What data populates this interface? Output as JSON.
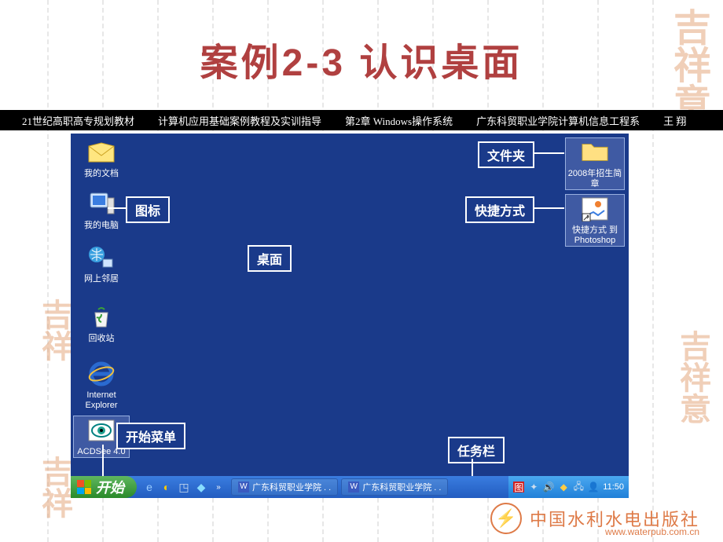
{
  "slide": {
    "title": "案例2-3  认识桌面"
  },
  "breadcrumb": {
    "b1": "21世纪高职高专规划教材",
    "b2": "计算机应用基础案例教程及实训指导",
    "b3": "第2章 Windows操作系统",
    "b4": "广东科贸职业学院计算机信息工程系",
    "b5": "王 翔"
  },
  "desktop": {
    "icons": {
      "mydocs": "我的文档",
      "mycomputer": "我的电脑",
      "network": "网上邻居",
      "recycle": "回收站",
      "ie": "Internet Explorer",
      "acdsee": "ACDSee 4.0",
      "folder2008": "2008年招生简章",
      "photoshop": "快捷方式 到 Photoshop"
    },
    "callouts": {
      "icon": "图标",
      "desktop": "桌面",
      "folder": "文件夹",
      "shortcut": "快捷方式",
      "startmenu": "开始菜单",
      "taskbar": "任务栏"
    },
    "taskbar": {
      "start": "开始",
      "task1": "广东科贸职业学院 . .",
      "task2": "广东科贸职业学院 . .",
      "time": "11:50"
    }
  },
  "brand": {
    "name": "中国水利水电出版社",
    "url": "www.waterpub.com.cn"
  },
  "watermarks": {
    "w1": "吉祥意",
    "w2": "吉祥",
    "w3": "吉祥意"
  }
}
